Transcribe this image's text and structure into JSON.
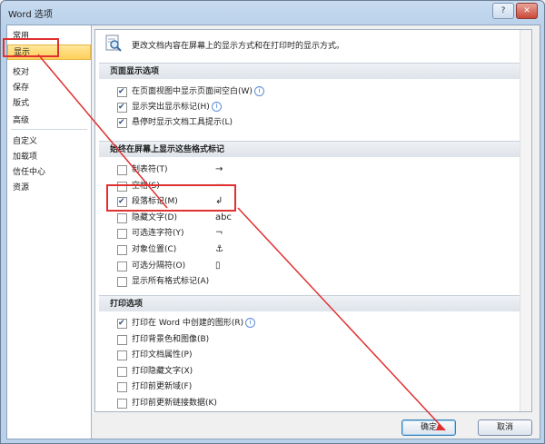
{
  "window": {
    "title": "Word 选项",
    "help_btn": "?",
    "close_btn": "✕"
  },
  "nav": {
    "items": [
      {
        "label": "常用",
        "selected": false
      },
      {
        "label": "显示",
        "selected": true
      },
      {
        "label": "校对",
        "selected": false
      },
      {
        "label": "保存",
        "selected": false
      },
      {
        "label": "版式",
        "selected": false
      },
      {
        "label": "高级",
        "selected": false
      },
      {
        "label": "自定义",
        "selected": false
      },
      {
        "label": "加载项",
        "selected": false
      },
      {
        "label": "信任中心",
        "selected": false
      },
      {
        "label": "资源",
        "selected": false
      }
    ]
  },
  "header": {
    "text": "更改文档内容在屏幕上的显示方式和在打印时的显示方式。"
  },
  "sections": {
    "page": "页面显示选项",
    "marks": "始终在屏幕上显示这些格式标记",
    "print": "打印选项"
  },
  "page_options": [
    {
      "label": "在页面视图中显示页面间空白(W)",
      "checked": true,
      "info": "i"
    },
    {
      "label": "显示突出显示标记(H)",
      "checked": true,
      "info": "i"
    },
    {
      "label": "悬停时显示文档工具提示(L)",
      "checked": true,
      "info": ""
    }
  ],
  "mark_options": [
    {
      "label": "制表符(T)",
      "checked": false,
      "symbol": "→"
    },
    {
      "label": "空格(S)",
      "checked": false,
      "symbol": "···"
    },
    {
      "label": "段落标记(M)",
      "checked": true,
      "symbol": "↲"
    },
    {
      "label": "隐藏文字(D)",
      "checked": false,
      "symbol": "abc"
    },
    {
      "label": "可选连字符(Y)",
      "checked": false,
      "symbol": "¬"
    },
    {
      "label": "对象位置(C)",
      "checked": false,
      "symbol": "⚓"
    },
    {
      "label": "可选分隔符(O)",
      "checked": false,
      "symbol": "▯"
    },
    {
      "label": "显示所有格式标记(A)",
      "checked": false,
      "symbol": ""
    }
  ],
  "print_options": [
    {
      "label": "打印在 Word 中创建的图形(R)",
      "checked": true,
      "info": "i"
    },
    {
      "label": "打印背景色和图像(B)",
      "checked": false,
      "info": ""
    },
    {
      "label": "打印文档属性(P)",
      "checked": false,
      "info": ""
    },
    {
      "label": "打印隐藏文字(X)",
      "checked": false,
      "info": ""
    },
    {
      "label": "打印前更新域(F)",
      "checked": false,
      "info": ""
    },
    {
      "label": "打印前更新链接数据(K)",
      "checked": false,
      "info": ""
    }
  ],
  "buttons": {
    "ok": "确定",
    "cancel": "取消"
  },
  "colors": {
    "highlight": "#e03030",
    "selected_nav": "#ffd05b"
  }
}
